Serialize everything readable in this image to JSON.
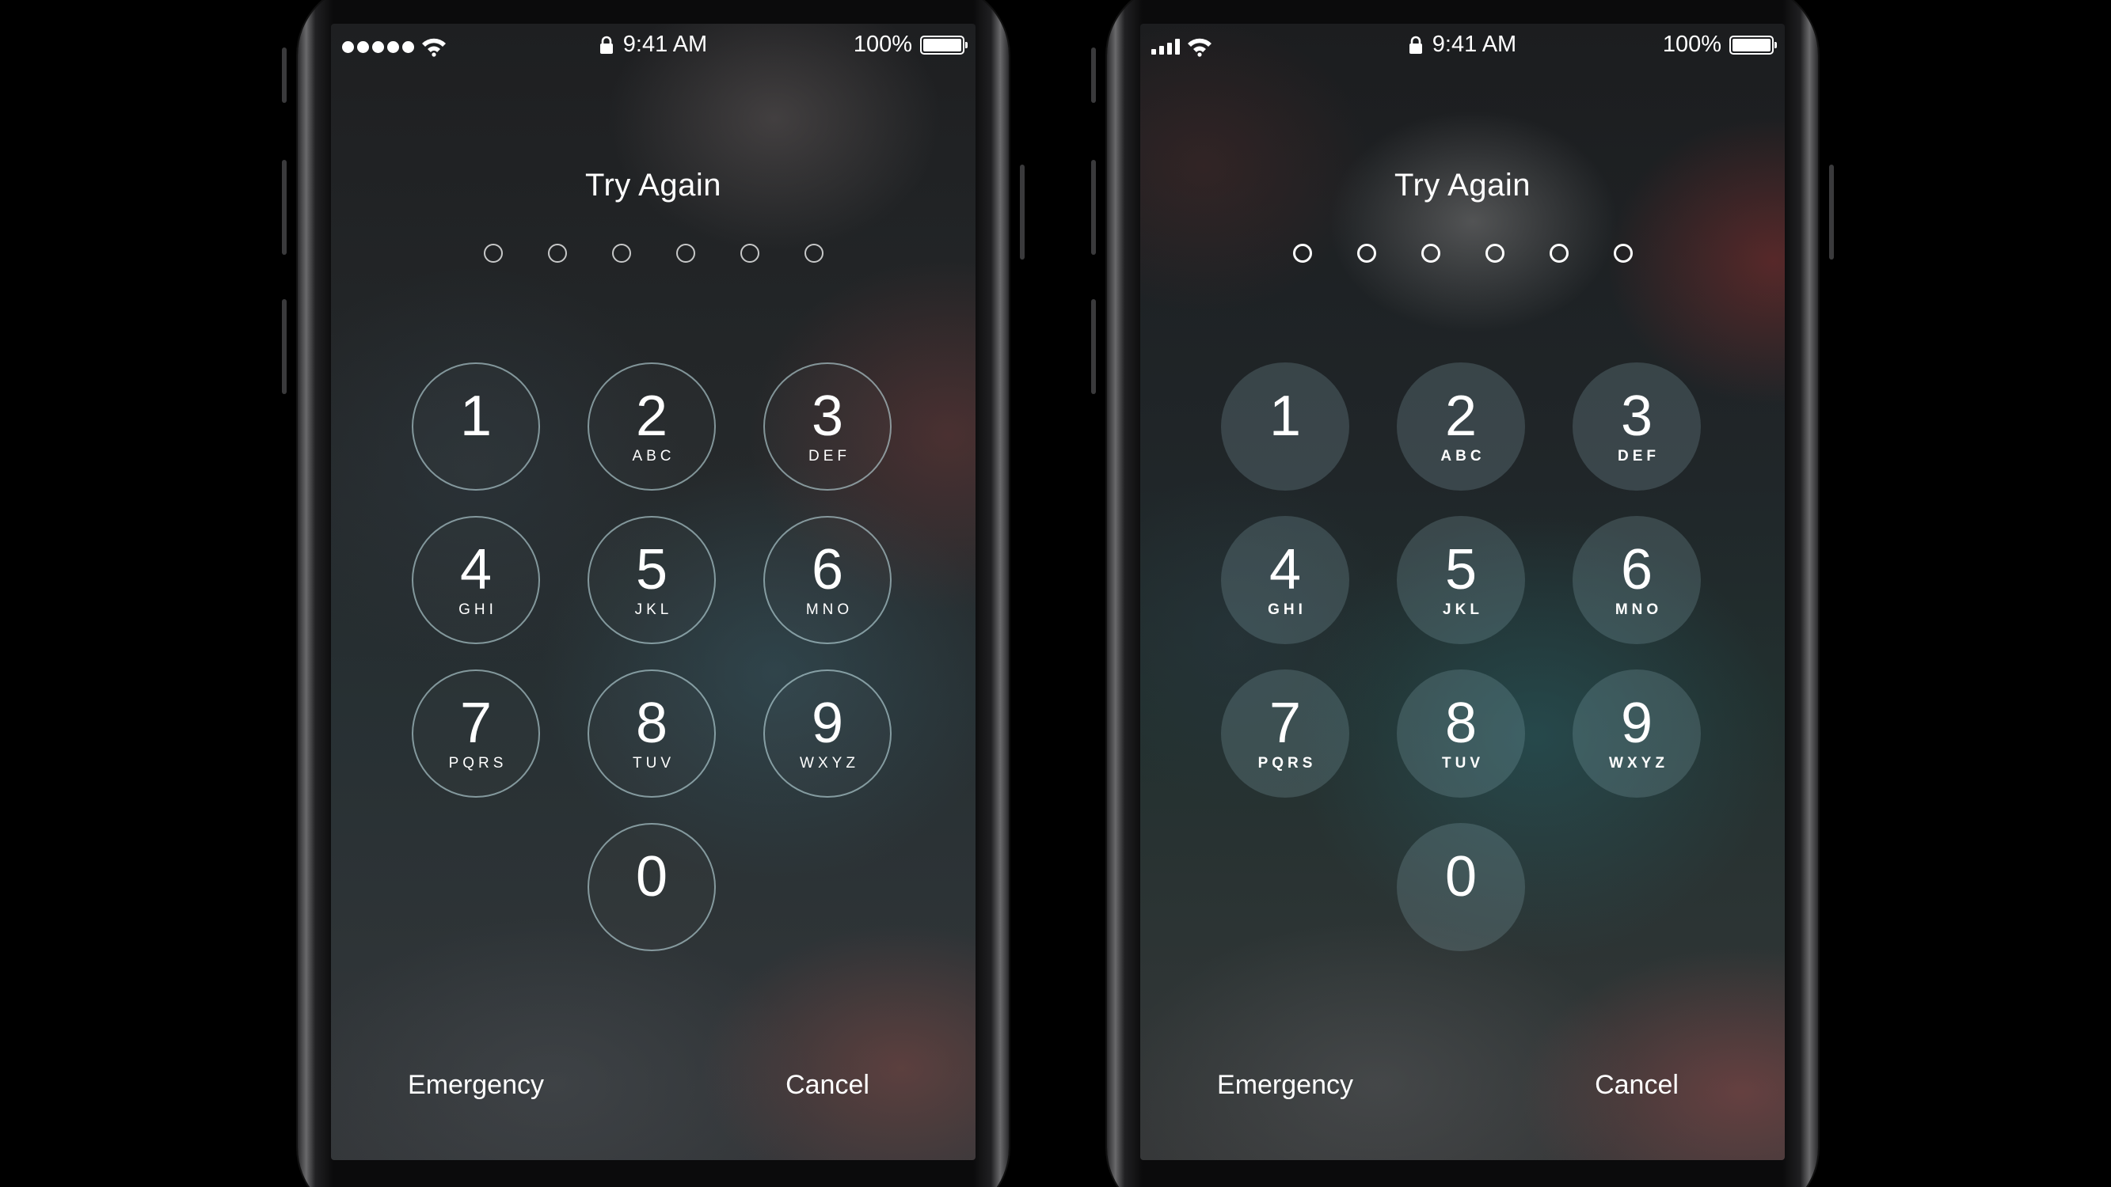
{
  "status_bar": {
    "time": "9:41 AM",
    "battery_percent": "100%"
  },
  "passcode": {
    "title": "Try Again",
    "entered_digits": 0,
    "total_digits": 6
  },
  "keypad": {
    "keys": [
      {
        "digit": "1",
        "letters": ""
      },
      {
        "digit": "2",
        "letters": "ABC"
      },
      {
        "digit": "3",
        "letters": "DEF"
      },
      {
        "digit": "4",
        "letters": "GHI"
      },
      {
        "digit": "5",
        "letters": "JKL"
      },
      {
        "digit": "6",
        "letters": "MNO"
      },
      {
        "digit": "7",
        "letters": "PQRS"
      },
      {
        "digit": "8",
        "letters": "TUV"
      },
      {
        "digit": "9",
        "letters": "WXYZ"
      },
      {
        "digit": "0",
        "letters": ""
      }
    ]
  },
  "actions": {
    "emergency_label": "Emergency",
    "cancel_label": "Cancel"
  }
}
